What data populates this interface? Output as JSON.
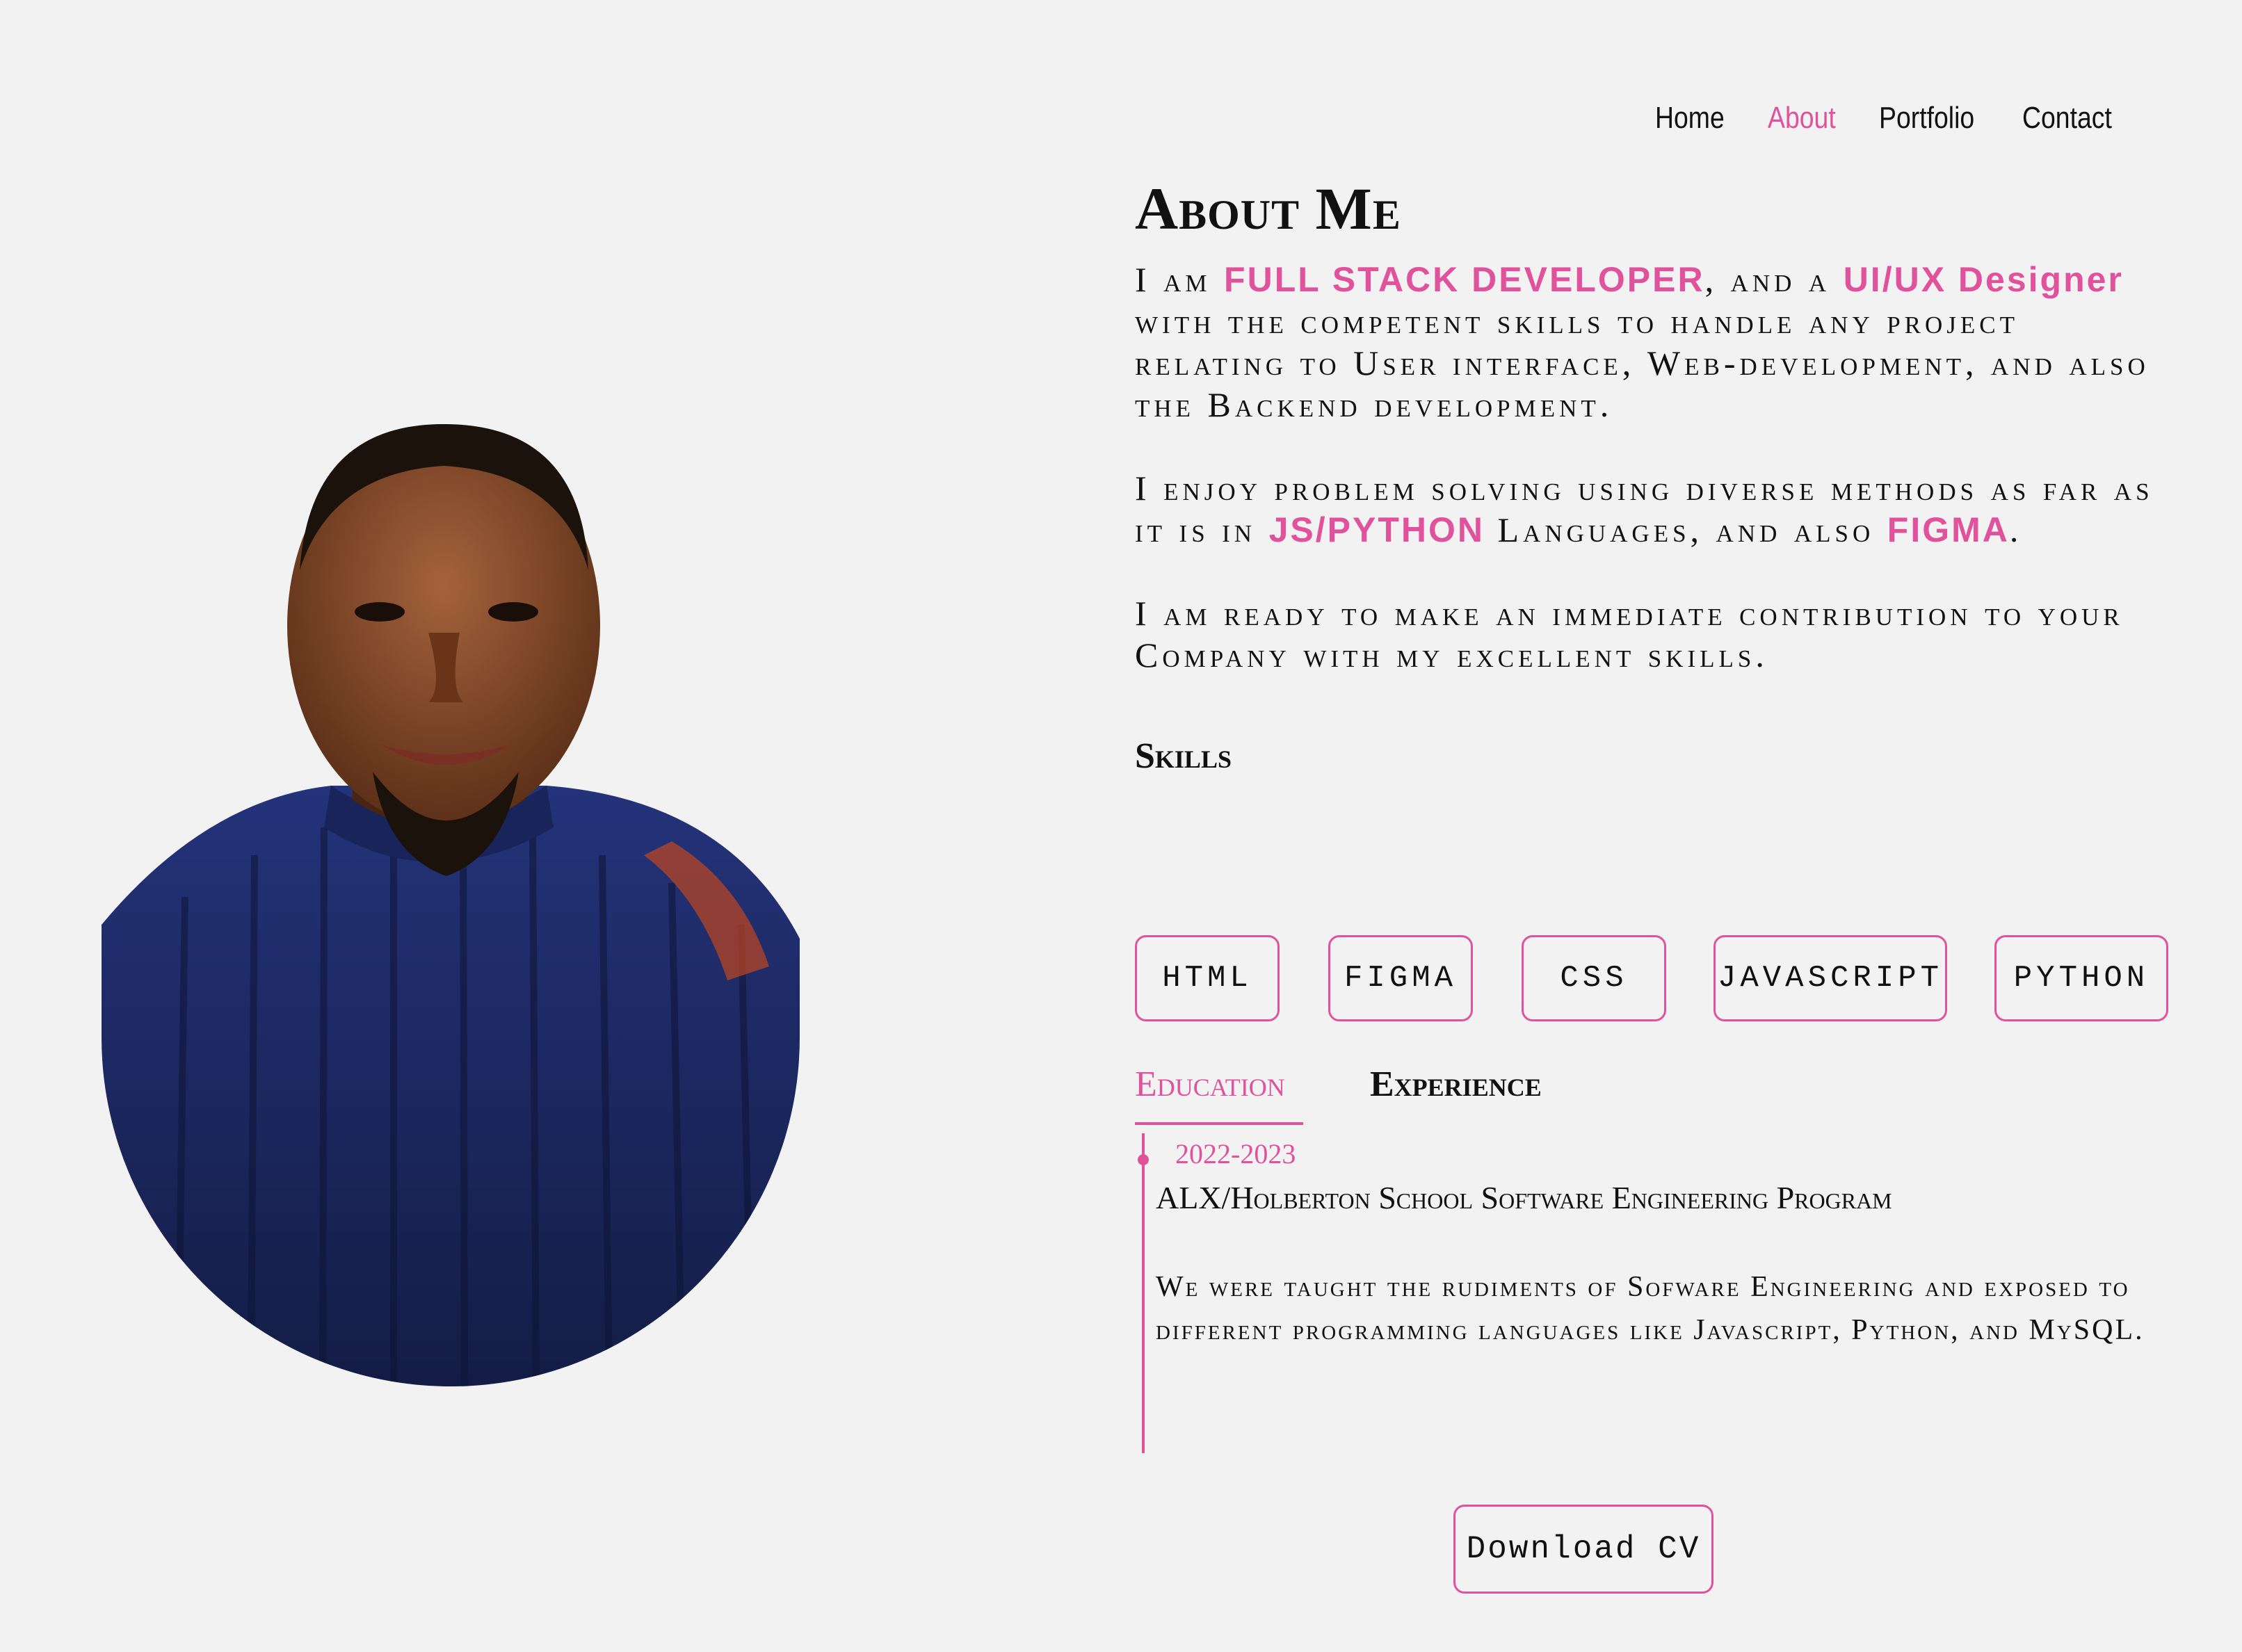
{
  "nav": {
    "items": [
      {
        "label": "Home",
        "active": false
      },
      {
        "label": "About",
        "active": true
      },
      {
        "label": "Portfolio",
        "active": false
      },
      {
        "label": "Contact",
        "active": false
      }
    ]
  },
  "about": {
    "title": "About Me",
    "p1": {
      "t1": "I am ",
      "h1": "FULL STACK DEVELOPER",
      "t2": ", and a ",
      "h2": "UI/UX Designer",
      "t3": " with the competent skills to handle any project relating to User interface, Web-development, and also the Backend development."
    },
    "p2": {
      "t1": "I enjoy problem solving using diverse methods as far as it is in ",
      "h1": "JS/PYTHON",
      "t2": " Languages, and also ",
      "h2": "FIGMA",
      "t3": "."
    },
    "p3": "I am ready to make an immediate contribution to your Company with my excellent skills."
  },
  "skills": {
    "title": "Skills",
    "items": [
      "HTML",
      "FIGMA",
      "CSS",
      "JAVASCRIPT",
      "PYTHON"
    ]
  },
  "tabs": {
    "education": "Education",
    "experience": "Experience"
  },
  "education": {
    "year": "2022-2023",
    "title": "ALX/Holberton School Software Engineering Program",
    "desc1": "We were taught the rudiments of Sofware Engineering and exposed to",
    "desc2": "different programming languages like Javascript, Python, and MySQL."
  },
  "cv_button": "Download CV",
  "colors": {
    "accent": "#e0529c",
    "background": "#f2f2f2",
    "sweater": "#1f2d63"
  },
  "photo": {
    "icon": "profile-photo"
  }
}
